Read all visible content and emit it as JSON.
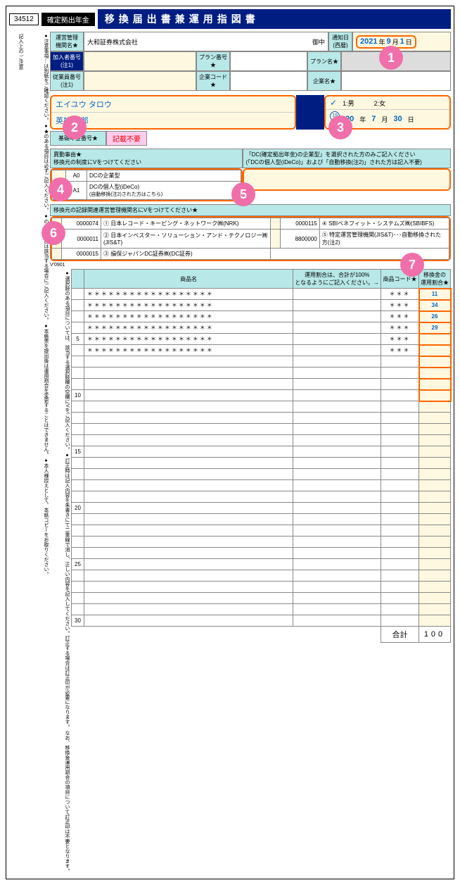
{
  "header": {
    "code": "34512",
    "category": "確定拠出年金",
    "title": "移換届出書兼運用指図書"
  },
  "topbox": {
    "label": "記入上の\nご注意"
  },
  "company": {
    "label": "運営管理\n機関名★",
    "name": "大和証券株式会社",
    "suffix": "御中"
  },
  "date_label": "通知日\n(西暦)",
  "date": {
    "y": "2021",
    "m": "9",
    "d": "1"
  },
  "ids": {
    "subscriber_lbl": "加入者番号\n(注1)",
    "employee_lbl": "従業員番号\n(注1)",
    "plan_no_lbl": "プラン番号★",
    "corp_code_lbl": "企業コード★",
    "plan_name_lbl": "プラン名★",
    "corp_name_lbl": "企業名★"
  },
  "name": {
    "kana": "エイユウ タロウ",
    "kanji": "英雄 太郎"
  },
  "gender": {
    "m": "1:男",
    "f": "2:女",
    "check": "✓"
  },
  "birth": {
    "era1": "19",
    "era2": "20",
    "y": "90",
    "m": "7",
    "d": "30"
  },
  "pension": {
    "lbl": "基礎年金番号★",
    "note": "記載不要"
  },
  "reason": {
    "header": "異動事由★\n移換元の制度にVをつけてください",
    "a0": "A0",
    "a0_txt": "DCの企業型",
    "a1": "A1",
    "a1_txt": "DCの個人型(iDeCo)",
    "a1_note": "(自動移換(注2)された方はこちら)"
  },
  "dc_note": "「DC(確定拠出年金)の企業型」を選択された方のみご記入ください\n(「DCの個人型(iDeCo)」および「自動移換(注2)」された方は記入不要)",
  "rk": {
    "header": "移換元の記録関連運営管理機関名にVをつけてください★",
    "items": [
      {
        "code": "0000074",
        "txt": "① 日本レコード・キーピング・ネットワーク㈱(NRK)"
      },
      {
        "code": "0000115",
        "txt": "④ SBIベネフィット・システムズ㈱(SBIBFS)"
      },
      {
        "code": "0000011",
        "txt": "② 日本インベスター・ソリューション・アンド・テクノロジー㈱(JIS&T)"
      },
      {
        "code": "8800000",
        "txt": "⑤ 特定運営管理機関(JIS&T)･･･自動移換された方(注2)"
      },
      {
        "code": "0000015",
        "txt": "③ 損保ジャパンDC証券㈱(DC証券)"
      }
    ]
  },
  "version": "V'0901",
  "prod_tbl": {
    "h1": "商品名",
    "h2": "運用割合は、合計が100%\nとなるようにご記入ください。→",
    "h3": "商品コード★",
    "h4": "移換金の\n運用割合★"
  },
  "rows": [
    {
      "n": "",
      "name": "＊＊＊＊＊＊＊＊＊＊＊＊＊＊＊＊＊＊",
      "code": "＊＊＊",
      "ratio": "11"
    },
    {
      "n": "",
      "name": "＊＊＊＊＊＊＊＊＊＊＊＊＊＊＊＊＊＊",
      "code": "＊＊＊",
      "ratio": "34"
    },
    {
      "n": "",
      "name": "＊＊＊＊＊＊＊＊＊＊＊＊＊＊＊＊＊＊",
      "code": "＊＊＊",
      "ratio": "26"
    },
    {
      "n": "",
      "name": "＊＊＊＊＊＊＊＊＊＊＊＊＊＊＊＊＊＊",
      "code": "＊＊＊",
      "ratio": "29"
    },
    {
      "n": "5",
      "name": "＊＊＊＊＊＊＊＊＊＊＊＊＊＊＊＊＊＊",
      "code": "＊＊＊",
      "ratio": ""
    },
    {
      "n": "",
      "name": "＊＊＊＊＊＊＊＊＊＊＊＊＊＊＊＊＊＊",
      "code": "＊＊＊",
      "ratio": ""
    }
  ],
  "empty_count": 24,
  "marks": {
    "r10": "10",
    "r15": "15",
    "r20": "20",
    "r25": "25",
    "r30": "30"
  },
  "total": {
    "lbl": "合計",
    "val": "100"
  },
  "notes_right": "●注意事項…は別紙をご確認ください。\n●★のある項目は必ずご記入ください。\n●のある項目は該当する場合にご記入ください。\n●本帳票を提出後は運用割合を変更することはできません。\n●本人様控えとして、本紙コピーをお取りください。",
  "notes_left": "●選択肢のある項目については、該当する選択肢欄の空欄にVをご記入ください。\n●訂正時は記入内容を朱書きにて二重線で消し、正しい内容を記入してください。訂正する場合は訂正印が必要になります。\nなお、移換金運用割合の項目について訂正印は不要となります。",
  "callouts": {
    "c1": "1",
    "c2": "2",
    "c3": "3",
    "c4": "4",
    "c5": "5",
    "c6": "6",
    "c7": "7"
  }
}
